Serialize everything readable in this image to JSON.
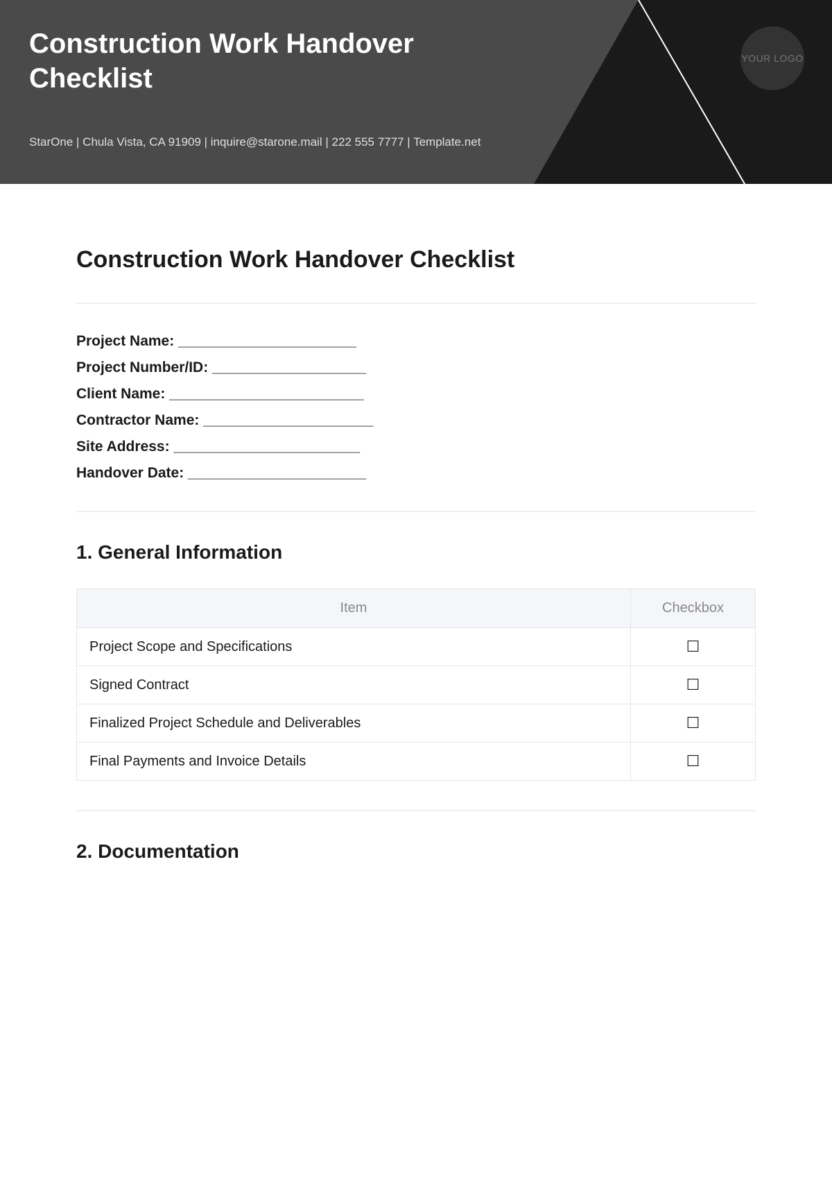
{
  "header": {
    "title": "Construction Work Handover Checklist",
    "info": "StarOne | Chula Vista, CA 91909 |  inquire@starone.mail | 222 555 7777 | Template.net",
    "logo_text": "YOUR LOGO"
  },
  "document": {
    "title": "Construction Work Handover Checklist"
  },
  "fields": [
    "Project Name: ______________________",
    "Project Number/ID: ___________________",
    "Client Name: ________________________",
    "Contractor Name: _____________________",
    "Site Address: _______________________",
    "Handover Date: ______________________"
  ],
  "sections": [
    {
      "heading": "1. General Information",
      "table": {
        "headers": [
          "Item",
          "Checkbox"
        ],
        "rows": [
          [
            "Project Scope and Specifications",
            "☐"
          ],
          [
            "Signed Contract",
            "☐"
          ],
          [
            "Finalized Project Schedule and Deliverables",
            "☐"
          ],
          [
            "Final Payments and Invoice Details",
            "☐"
          ]
        ]
      }
    },
    {
      "heading": "2. Documentation"
    }
  ]
}
